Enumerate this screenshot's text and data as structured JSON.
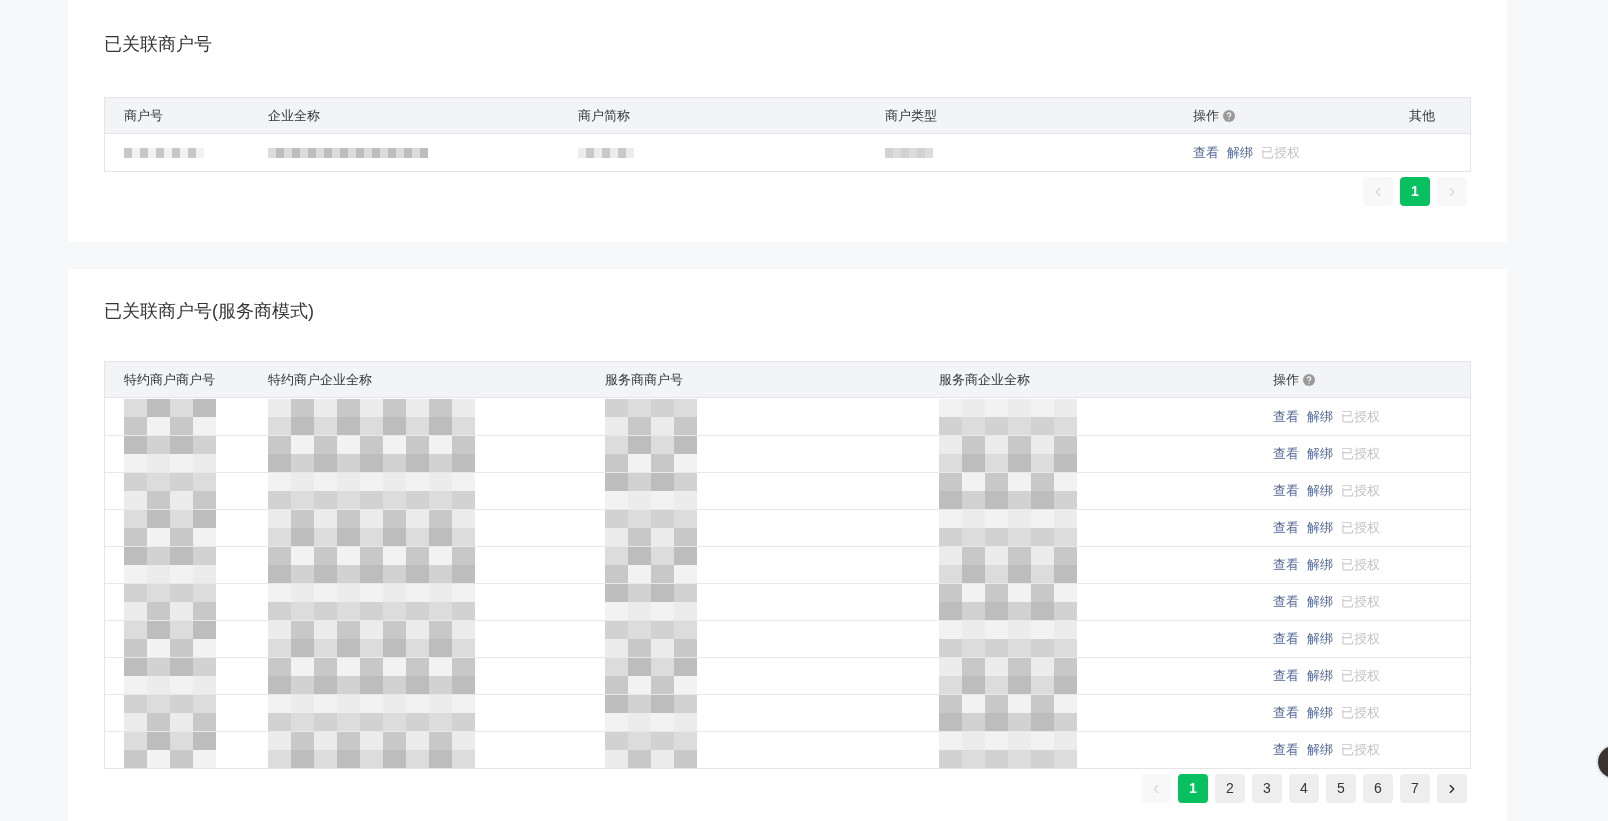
{
  "sections": [
    {
      "title": "已关联商户号",
      "table": {
        "columns": [
          {
            "label": "商户号",
            "kind": "redacted"
          },
          {
            "label": "企业全称",
            "kind": "redacted"
          },
          {
            "label": "商户简称",
            "kind": "redacted"
          },
          {
            "label": "商户类型",
            "kind": "redacted"
          },
          {
            "label": "操作",
            "kind": "actions",
            "help": true
          },
          {
            "label": "其他",
            "kind": "empty"
          }
        ],
        "rows": [
          {
            "actions": [
              {
                "label": "查看",
                "disabled": false
              },
              {
                "label": "解绑",
                "disabled": false
              },
              {
                "label": "已授权",
                "disabled": true
              }
            ]
          }
        ]
      },
      "pagination": {
        "prev": {
          "disabled": true
        },
        "pages": [
          {
            "label": "1",
            "selected": true
          }
        ],
        "next": {
          "disabled": true
        }
      }
    },
    {
      "title": "已关联商户号(服务商模式)",
      "table": {
        "columns": [
          {
            "label": "特约商户商户号",
            "kind": "redacted"
          },
          {
            "label": "特约商户企业全称",
            "kind": "redacted"
          },
          {
            "label": "服务商商户号",
            "kind": "redacted"
          },
          {
            "label": "服务商企业全称",
            "kind": "redacted"
          },
          {
            "label": "操作",
            "kind": "actions",
            "help": true
          }
        ],
        "rows": [
          {
            "actions": [
              {
                "label": "查看",
                "disabled": false
              },
              {
                "label": "解绑",
                "disabled": false
              },
              {
                "label": "已授权",
                "disabled": true
              }
            ]
          },
          {
            "actions": [
              {
                "label": "查看",
                "disabled": false
              },
              {
                "label": "解绑",
                "disabled": false
              },
              {
                "label": "已授权",
                "disabled": true
              }
            ]
          },
          {
            "actions": [
              {
                "label": "查看",
                "disabled": false
              },
              {
                "label": "解绑",
                "disabled": false
              },
              {
                "label": "已授权",
                "disabled": true
              }
            ]
          },
          {
            "actions": [
              {
                "label": "查看",
                "disabled": false
              },
              {
                "label": "解绑",
                "disabled": false
              },
              {
                "label": "已授权",
                "disabled": true
              }
            ]
          },
          {
            "actions": [
              {
                "label": "查看",
                "disabled": false
              },
              {
                "label": "解绑",
                "disabled": false
              },
              {
                "label": "已授权",
                "disabled": true
              }
            ]
          },
          {
            "actions": [
              {
                "label": "查看",
                "disabled": false
              },
              {
                "label": "解绑",
                "disabled": false
              },
              {
                "label": "已授权",
                "disabled": true
              }
            ]
          },
          {
            "actions": [
              {
                "label": "查看",
                "disabled": false
              },
              {
                "label": "解绑",
                "disabled": false
              },
              {
                "label": "已授权",
                "disabled": true
              }
            ]
          },
          {
            "actions": [
              {
                "label": "查看",
                "disabled": false
              },
              {
                "label": "解绑",
                "disabled": false
              },
              {
                "label": "已授权",
                "disabled": true
              }
            ]
          },
          {
            "actions": [
              {
                "label": "查看",
                "disabled": false
              },
              {
                "label": "解绑",
                "disabled": false
              },
              {
                "label": "已授权",
                "disabled": true
              }
            ]
          },
          {
            "actions": [
              {
                "label": "查看",
                "disabled": false
              },
              {
                "label": "解绑",
                "disabled": false
              },
              {
                "label": "已授权",
                "disabled": true
              }
            ]
          }
        ]
      },
      "pagination": {
        "prev": {
          "disabled": true
        },
        "pages": [
          {
            "label": "1",
            "selected": true
          },
          {
            "label": "2",
            "selected": false
          },
          {
            "label": "3",
            "selected": false
          },
          {
            "label": "4",
            "selected": false
          },
          {
            "label": "5",
            "selected": false
          },
          {
            "label": "6",
            "selected": false
          },
          {
            "label": "7",
            "selected": false
          }
        ],
        "next": {
          "disabled": false
        }
      }
    }
  ]
}
